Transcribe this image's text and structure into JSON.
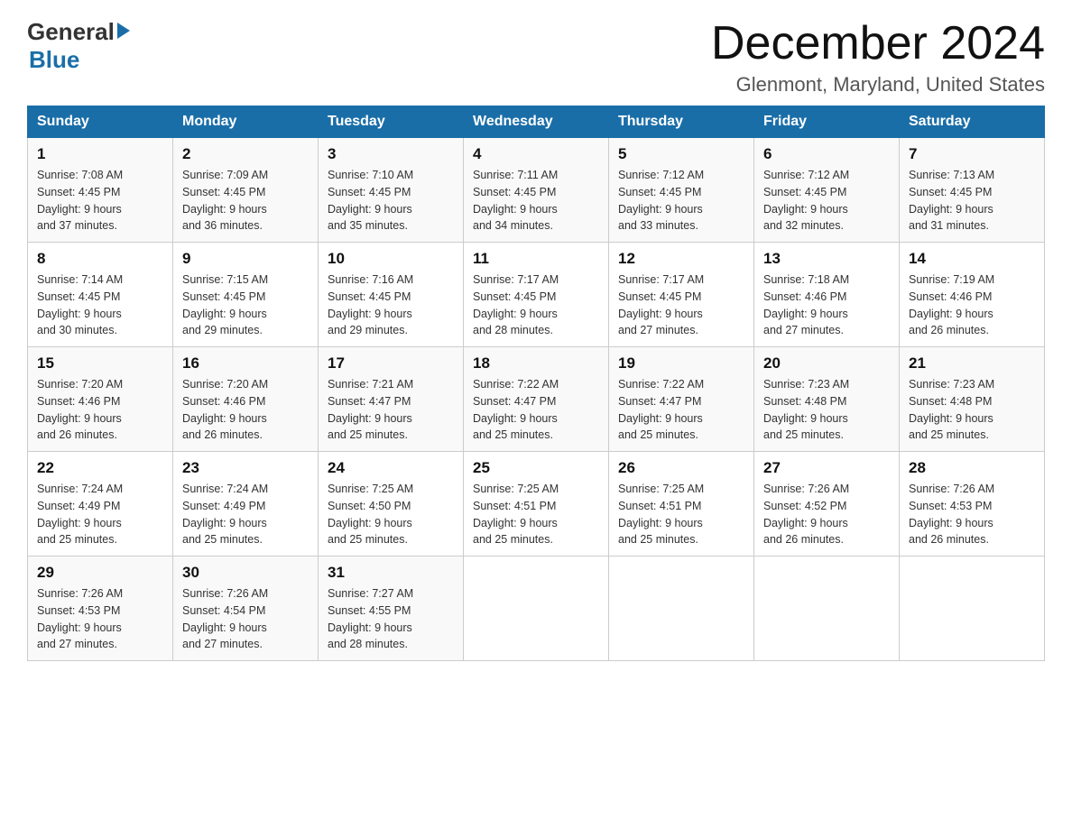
{
  "header": {
    "logo_general": "General",
    "logo_blue": "Blue",
    "month_title": "December 2024",
    "location": "Glenmont, Maryland, United States"
  },
  "weekdays": [
    "Sunday",
    "Monday",
    "Tuesday",
    "Wednesday",
    "Thursday",
    "Friday",
    "Saturday"
  ],
  "weeks": [
    [
      {
        "day": "1",
        "sunrise": "7:08 AM",
        "sunset": "4:45 PM",
        "daylight": "9 hours and 37 minutes."
      },
      {
        "day": "2",
        "sunrise": "7:09 AM",
        "sunset": "4:45 PM",
        "daylight": "9 hours and 36 minutes."
      },
      {
        "day": "3",
        "sunrise": "7:10 AM",
        "sunset": "4:45 PM",
        "daylight": "9 hours and 35 minutes."
      },
      {
        "day": "4",
        "sunrise": "7:11 AM",
        "sunset": "4:45 PM",
        "daylight": "9 hours and 34 minutes."
      },
      {
        "day": "5",
        "sunrise": "7:12 AM",
        "sunset": "4:45 PM",
        "daylight": "9 hours and 33 minutes."
      },
      {
        "day": "6",
        "sunrise": "7:12 AM",
        "sunset": "4:45 PM",
        "daylight": "9 hours and 32 minutes."
      },
      {
        "day": "7",
        "sunrise": "7:13 AM",
        "sunset": "4:45 PM",
        "daylight": "9 hours and 31 minutes."
      }
    ],
    [
      {
        "day": "8",
        "sunrise": "7:14 AM",
        "sunset": "4:45 PM",
        "daylight": "9 hours and 30 minutes."
      },
      {
        "day": "9",
        "sunrise": "7:15 AM",
        "sunset": "4:45 PM",
        "daylight": "9 hours and 29 minutes."
      },
      {
        "day": "10",
        "sunrise": "7:16 AM",
        "sunset": "4:45 PM",
        "daylight": "9 hours and 29 minutes."
      },
      {
        "day": "11",
        "sunrise": "7:17 AM",
        "sunset": "4:45 PM",
        "daylight": "9 hours and 28 minutes."
      },
      {
        "day": "12",
        "sunrise": "7:17 AM",
        "sunset": "4:45 PM",
        "daylight": "9 hours and 27 minutes."
      },
      {
        "day": "13",
        "sunrise": "7:18 AM",
        "sunset": "4:46 PM",
        "daylight": "9 hours and 27 minutes."
      },
      {
        "day": "14",
        "sunrise": "7:19 AM",
        "sunset": "4:46 PM",
        "daylight": "9 hours and 26 minutes."
      }
    ],
    [
      {
        "day": "15",
        "sunrise": "7:20 AM",
        "sunset": "4:46 PM",
        "daylight": "9 hours and 26 minutes."
      },
      {
        "day": "16",
        "sunrise": "7:20 AM",
        "sunset": "4:46 PM",
        "daylight": "9 hours and 26 minutes."
      },
      {
        "day": "17",
        "sunrise": "7:21 AM",
        "sunset": "4:47 PM",
        "daylight": "9 hours and 25 minutes."
      },
      {
        "day": "18",
        "sunrise": "7:22 AM",
        "sunset": "4:47 PM",
        "daylight": "9 hours and 25 minutes."
      },
      {
        "day": "19",
        "sunrise": "7:22 AM",
        "sunset": "4:47 PM",
        "daylight": "9 hours and 25 minutes."
      },
      {
        "day": "20",
        "sunrise": "7:23 AM",
        "sunset": "4:48 PM",
        "daylight": "9 hours and 25 minutes."
      },
      {
        "day": "21",
        "sunrise": "7:23 AM",
        "sunset": "4:48 PM",
        "daylight": "9 hours and 25 minutes."
      }
    ],
    [
      {
        "day": "22",
        "sunrise": "7:24 AM",
        "sunset": "4:49 PM",
        "daylight": "9 hours and 25 minutes."
      },
      {
        "day": "23",
        "sunrise": "7:24 AM",
        "sunset": "4:49 PM",
        "daylight": "9 hours and 25 minutes."
      },
      {
        "day": "24",
        "sunrise": "7:25 AM",
        "sunset": "4:50 PM",
        "daylight": "9 hours and 25 minutes."
      },
      {
        "day": "25",
        "sunrise": "7:25 AM",
        "sunset": "4:51 PM",
        "daylight": "9 hours and 25 minutes."
      },
      {
        "day": "26",
        "sunrise": "7:25 AM",
        "sunset": "4:51 PM",
        "daylight": "9 hours and 25 minutes."
      },
      {
        "day": "27",
        "sunrise": "7:26 AM",
        "sunset": "4:52 PM",
        "daylight": "9 hours and 26 minutes."
      },
      {
        "day": "28",
        "sunrise": "7:26 AM",
        "sunset": "4:53 PM",
        "daylight": "9 hours and 26 minutes."
      }
    ],
    [
      {
        "day": "29",
        "sunrise": "7:26 AM",
        "sunset": "4:53 PM",
        "daylight": "9 hours and 27 minutes."
      },
      {
        "day": "30",
        "sunrise": "7:26 AM",
        "sunset": "4:54 PM",
        "daylight": "9 hours and 27 minutes."
      },
      {
        "day": "31",
        "sunrise": "7:27 AM",
        "sunset": "4:55 PM",
        "daylight": "9 hours and 28 minutes."
      },
      null,
      null,
      null,
      null
    ]
  ],
  "labels": {
    "sunrise": "Sunrise:",
    "sunset": "Sunset:",
    "daylight": "Daylight:"
  }
}
